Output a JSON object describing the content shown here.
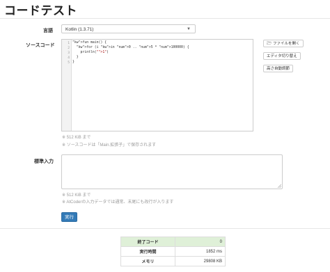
{
  "page": {
    "title": "コードテスト"
  },
  "form": {
    "language_label": "言語",
    "language_value": "Kotlin (1.3.71)",
    "source_label": "ソースコード",
    "stdin_label": "標準入力",
    "submit_label": "実行"
  },
  "editor": {
    "line_numbers": [
      "1",
      "2",
      "3",
      "4",
      "5"
    ],
    "lines": [
      "fun main() {",
      "  for (i in 0 .. 5 * 100000) {",
      "    println(\"1\")",
      "  }",
      "}"
    ]
  },
  "buttons": {
    "open_file": "ファイルを開く",
    "toggle_editor": "エディタ切り替え",
    "auto_height": "高さ自動調節"
  },
  "notes": {
    "source_size": "※ 512 KiB まで",
    "source_filename": "※ ソースコードは「Main.拡張子」で保存されます",
    "stdin_size": "※ 512 KiB まで",
    "stdin_newline": "※ AtCoderの入力データでは通常、末尾にも改行が入ります"
  },
  "result": {
    "rows": [
      {
        "key": "終了コード",
        "value": "0"
      },
      {
        "key": "実行時間",
        "value": "1852 ms"
      },
      {
        "key": "メモリ",
        "value": "29808 KB"
      }
    ]
  },
  "colors": {
    "primary": "#337ab7",
    "success_bg": "#dff0d8"
  }
}
